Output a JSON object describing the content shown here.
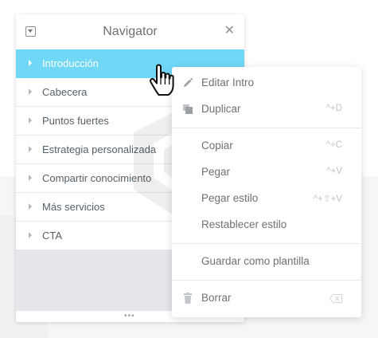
{
  "navigator": {
    "title": "Navigator",
    "close_glyph": "✕",
    "collapse_icon": "collapse-icon",
    "items": [
      {
        "label": "Introducción",
        "selected": true
      },
      {
        "label": "Cabecera",
        "selected": false
      },
      {
        "label": "Puntos fuertes",
        "selected": false
      },
      {
        "label": "Estrategia personalizada",
        "selected": false
      },
      {
        "label": "Compartir conocimiento",
        "selected": false
      },
      {
        "label": "Más servicios",
        "selected": false
      },
      {
        "label": "CTA",
        "selected": false
      }
    ],
    "footer_glyph": "•••"
  },
  "context_menu": {
    "edit": {
      "label": "Editar Intro",
      "icon": "pencil-icon"
    },
    "duplicate": {
      "label": "Duplicar",
      "shortcut": "^+D",
      "icon": "duplicate-icon"
    },
    "copy": {
      "label": "Copiar",
      "shortcut": "^+C"
    },
    "paste": {
      "label": "Pegar",
      "shortcut": "^+V"
    },
    "paste_style": {
      "label": "Pegar estilo",
      "shortcut": "^+⇧+V"
    },
    "reset_style": {
      "label": "Restablecer estilo"
    },
    "save_template": {
      "label": "Guardar como plantilla"
    },
    "delete": {
      "label": "Borrar",
      "icon": "trash-icon",
      "shortcut_icon": "backspace-icon"
    }
  },
  "colors": {
    "selected_item": "#71d7f7",
    "text": "#6d7075",
    "shortcut": "#c2c5c9"
  }
}
